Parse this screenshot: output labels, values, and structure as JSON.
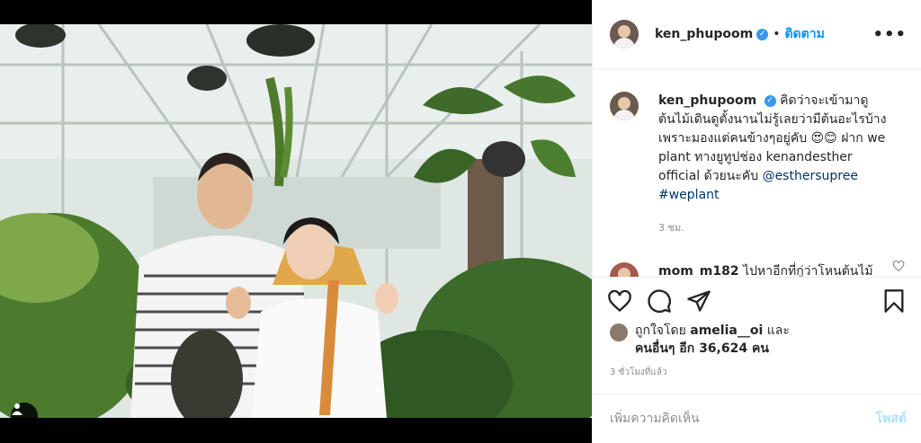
{
  "header": {
    "username": "ken_phupoom",
    "separator": "•",
    "follow_label": "ติดตาม",
    "more_icon": "more-options-icon"
  },
  "caption": {
    "username": "ken_phupoom",
    "text_1": "คิดว่าจะเข้ามาดูต้นไม้เดินดูตั้งนานไม่รู้เลยว่ามีต้นอะไรบ้าง เพราะมองแต่คนข้างๆอยู่คับ",
    "emoji": "😍😊",
    "text_2": "ฝาก we plant ทางยูทูปช่อง kenandesther official ด้วยนะคับ",
    "mention": "@esthersupree",
    "hashtag": "#weplant",
    "time": "3 ชม."
  },
  "comment": {
    "username": "mom_m182",
    "text": "ไปหาอีกที่กู่ว่าโหนต้นไม้"
  },
  "likes": {
    "prefix": "ถูกใจโดย",
    "user": "amelia__oi",
    "and": "และ",
    "others": "คนอื่นๆ อีก 36,624 คน"
  },
  "post_time": "3 ชั่วโมงที่แล้ว",
  "add_comment": {
    "placeholder": "เพิ่มความคิดเห็น",
    "post_label": "โพสต์"
  },
  "colors": {
    "accent": "#0095f6",
    "verified": "#3897f0",
    "muted": "#8e8e8e",
    "post_disabled": "#b2dffc"
  }
}
